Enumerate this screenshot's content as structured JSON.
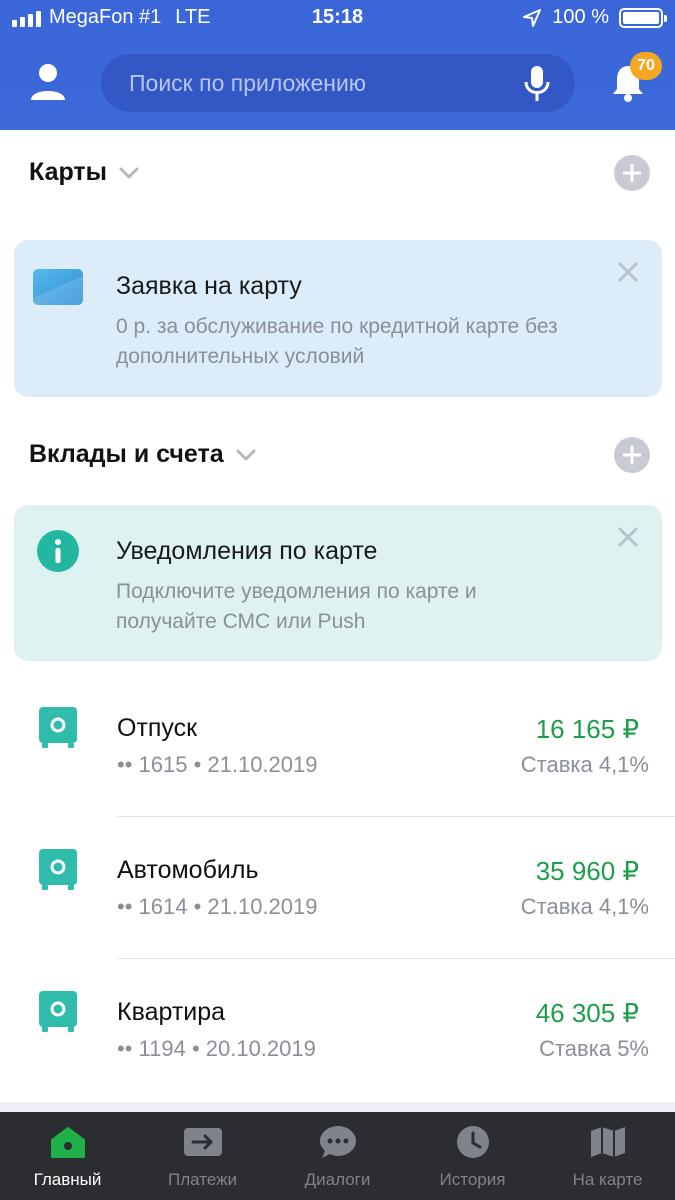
{
  "status_bar": {
    "carrier": "MegaFon #1",
    "network": "LTE",
    "time": "15:18",
    "battery": "100 %"
  },
  "header": {
    "search_placeholder": "Поиск по приложению",
    "notifications_count": "70",
    "icons": {
      "profile": "person-icon",
      "mic": "microphone-icon",
      "bell": "bell-icon"
    }
  },
  "cards_section": {
    "title": "Карты"
  },
  "card_promo": {
    "title": "Заявка на карту",
    "text": "0 р. за обслуживание по кредитной карте без дополнительных условий",
    "icon": "credit-card-icon",
    "bg_color": "#dcedf9"
  },
  "deposits_section": {
    "title": "Вклады и счета"
  },
  "notify_promo": {
    "title": "Уведомления по карте",
    "text": "Подключите уведомления по карте и получайте СМС или Push",
    "icon": "info-icon",
    "bg_color": "#def3f1"
  },
  "deposits": [
    {
      "name": "Отпуск",
      "meta": "•• 1615 • 21.10.2019",
      "amount": "16 165 ₽",
      "rate": "Ставка 4,1%"
    },
    {
      "name": "Автомобиль",
      "meta": "•• 1614 • 21.10.2019",
      "amount": "35 960 ₽",
      "rate": "Ставка 4,1%"
    },
    {
      "name": "Квартира",
      "meta": "•• 1194 • 20.10.2019",
      "amount": "46 305 ₽",
      "rate": "Ставка 5%"
    }
  ],
  "tabs": [
    {
      "label": "Главный",
      "icon": "home-icon",
      "active": true
    },
    {
      "label": "Платежи",
      "icon": "transfer-icon",
      "active": false
    },
    {
      "label": "Диалоги",
      "icon": "chat-icon",
      "active": false
    },
    {
      "label": "История",
      "icon": "clock-icon",
      "active": false
    },
    {
      "label": "На карте",
      "icon": "map-icon",
      "active": false
    }
  ],
  "colors": {
    "header": "#3c6ad9",
    "accent_green": "#1e9e4a",
    "deposit_icon": "#2fbcab",
    "badge": "#f5a623"
  }
}
